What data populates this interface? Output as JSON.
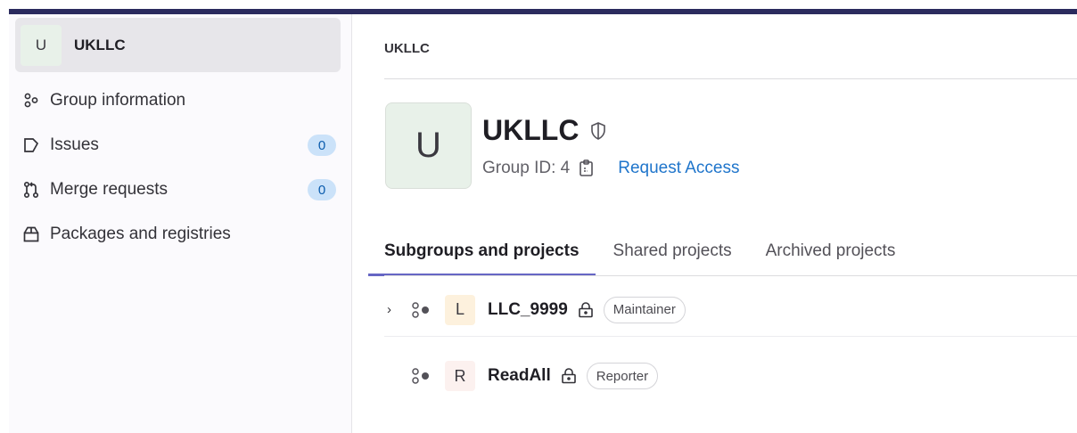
{
  "group": {
    "avatar_letter": "U",
    "name": "UKLLC"
  },
  "sidebar": {
    "items": [
      {
        "label": "Group information",
        "icon": "group-icon"
      },
      {
        "label": "Issues",
        "icon": "issues-icon",
        "count": "0"
      },
      {
        "label": "Merge requests",
        "icon": "merge-request-icon",
        "count": "0"
      },
      {
        "label": "Packages and registries",
        "icon": "package-icon"
      }
    ]
  },
  "breadcrumb": "UKLLC",
  "header": {
    "avatar_letter": "U",
    "title": "UKLLC",
    "group_id": "Group ID: 4",
    "request_access": "Request Access"
  },
  "tabs": [
    {
      "label": "Subgroups and projects",
      "active": true
    },
    {
      "label": "Shared projects",
      "active": false
    },
    {
      "label": "Archived projects",
      "active": false
    }
  ],
  "rows": [
    {
      "avatar_letter": "L",
      "name": "LLC_9999",
      "role": "Maintainer",
      "expandable": true,
      "avatar_color": "#fdf1dd"
    },
    {
      "avatar_letter": "R",
      "name": "ReadAll",
      "role": "Reporter",
      "expandable": false,
      "avatar_color": "#fcf1ef"
    }
  ],
  "colors": {
    "accent": "#6666c4",
    "link": "#1f75cb",
    "topbar": "#2b2b5e"
  }
}
